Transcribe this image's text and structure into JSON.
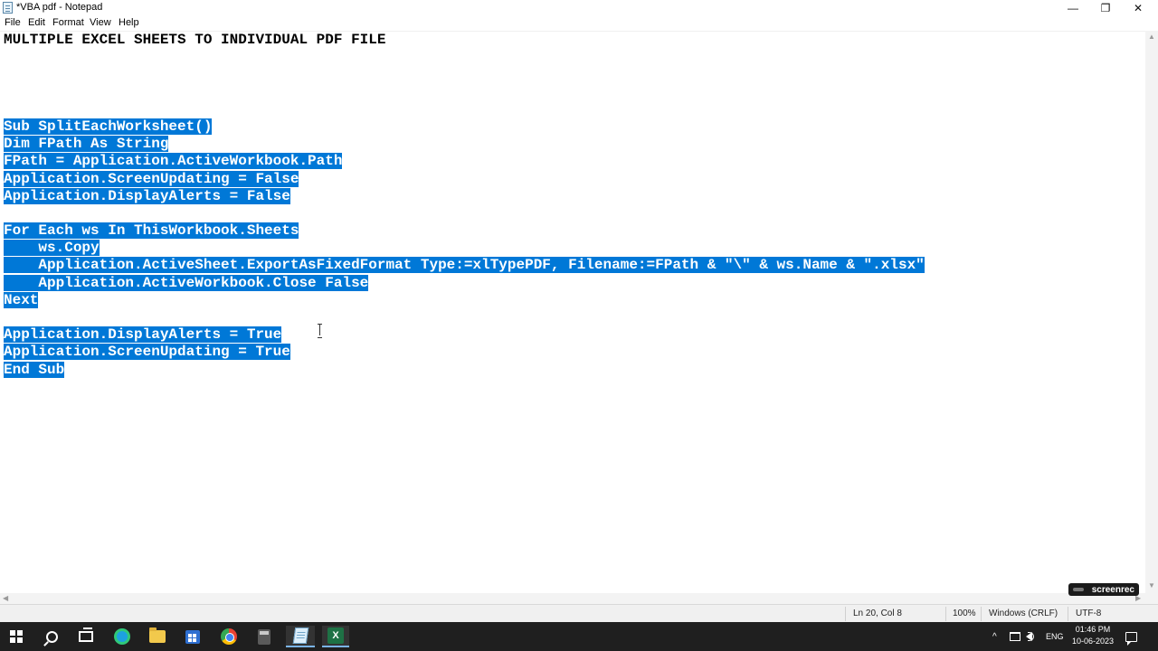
{
  "window": {
    "title": "*VBA pdf - Notepad",
    "minimize_glyph": "—",
    "maximize_glyph": "❐",
    "close_glyph": "✕"
  },
  "menu": {
    "items": [
      "File",
      "Edit",
      "Format",
      "View",
      "Help"
    ]
  },
  "editor": {
    "lines": [
      "MULTIPLE EXCEL SHEETS TO INDIVIDUAL PDF FILE",
      "",
      "",
      "",
      "",
      "Sub SplitEachWorksheet()",
      "Dim FPath As String",
      "FPath = Application.ActiveWorkbook.Path",
      "Application.ScreenUpdating = False",
      "Application.DisplayAlerts = False",
      "",
      "For Each ws In ThisWorkbook.Sheets",
      "    ws.Copy",
      "    Application.ActiveSheet.ExportAsFixedFormat Type:=xlTypePDF, Filename:=FPath & \"\\\" & ws.Name & \".xlsx\"",
      "    Application.ActiveWorkbook.Close False",
      "Next",
      "",
      "Application.DisplayAlerts = True",
      "Application.ScreenUpdating = True",
      "End Sub"
    ],
    "selection_start_line": 5,
    "selection_end_line": 19
  },
  "scrollbars": {
    "up_glyph": "▲",
    "down_glyph": "▼",
    "left_glyph": "◀",
    "right_glyph": "▶"
  },
  "watermark": {
    "text": "screenrec"
  },
  "status": {
    "position": "Ln 20, Col 8",
    "zoom": "100%",
    "line_ending": "Windows (CRLF)",
    "encoding": "UTF-8"
  },
  "taskbar": {
    "apps": [
      "start-icon",
      "search-icon",
      "task-view-icon",
      "edge-icon",
      "file-explorer-icon",
      "store-icon",
      "chrome-icon",
      "calculator-icon",
      "notepad-icon",
      "excel-icon"
    ],
    "excel_letter": "X",
    "tray_chevron": "^",
    "language": "ENG",
    "time": "01:46 PM",
    "date": "10-06-2023"
  },
  "colors": {
    "selection": "#0078d7",
    "taskbar": "#1f1f1f"
  }
}
